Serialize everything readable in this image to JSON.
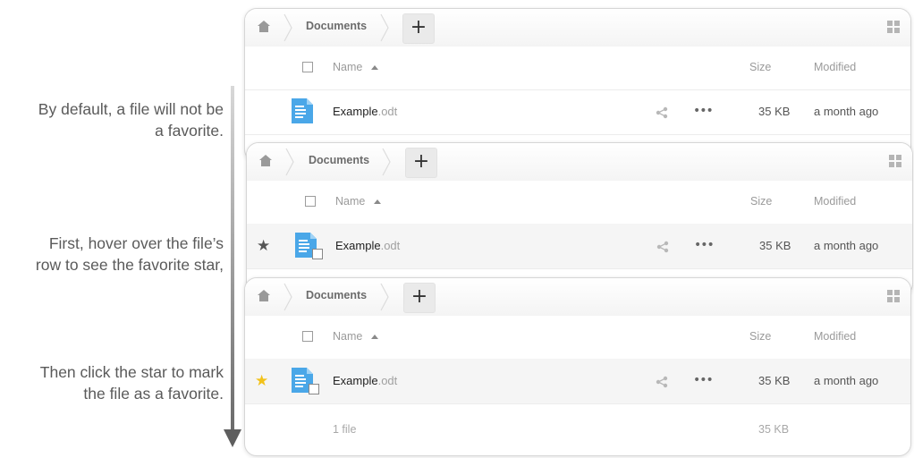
{
  "captions": [
    {
      "lines": [
        "By default, a file will not be",
        "a favorite."
      ]
    },
    {
      "lines": [
        "First, hover over the file’s",
        "row to see the favorite star,"
      ]
    },
    {
      "lines": [
        "Then click the star to mark",
        "the file as a favorite."
      ]
    }
  ],
  "breadcrumb": {
    "folder": "Documents",
    "add_label": "+"
  },
  "columns": {
    "name": "Name",
    "size": "Size",
    "modified": "Modified"
  },
  "file": {
    "base": "Example",
    "ext": ".odt",
    "size": "35 KB",
    "modified": "a month ago"
  },
  "summary": {
    "count": "1 file",
    "total": "35 KB"
  },
  "colors": {
    "file_icon": "#4aa7e8",
    "star_active": "#f2c21a",
    "star_hover": "#555555"
  }
}
